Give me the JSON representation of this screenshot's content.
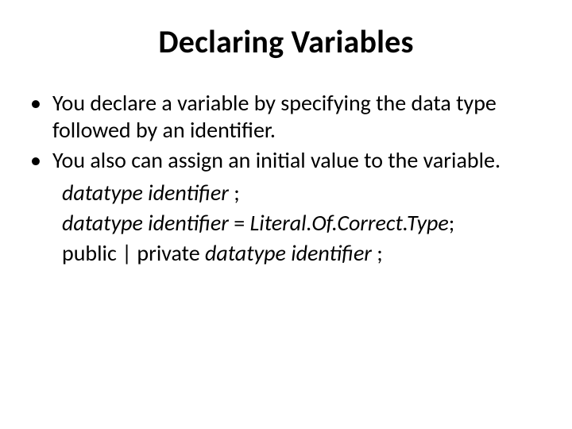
{
  "title": "Declaring Variables",
  "bullets": [
    "You declare a variable by specifying the data type followed by an identifier.",
    "You also can assign an initial value to the variable."
  ],
  "syntax": {
    "line1": {
      "p1": "datatype identifier",
      "p2": " ;"
    },
    "line2": {
      "p1": "datatype identifier",
      "p2": " = ",
      "p3": "Literal.Of.Correct.Type",
      "p4": ";"
    },
    "line3": {
      "p1": "public | private ",
      "p2": "datatype identifier",
      "p3": " ;"
    }
  }
}
